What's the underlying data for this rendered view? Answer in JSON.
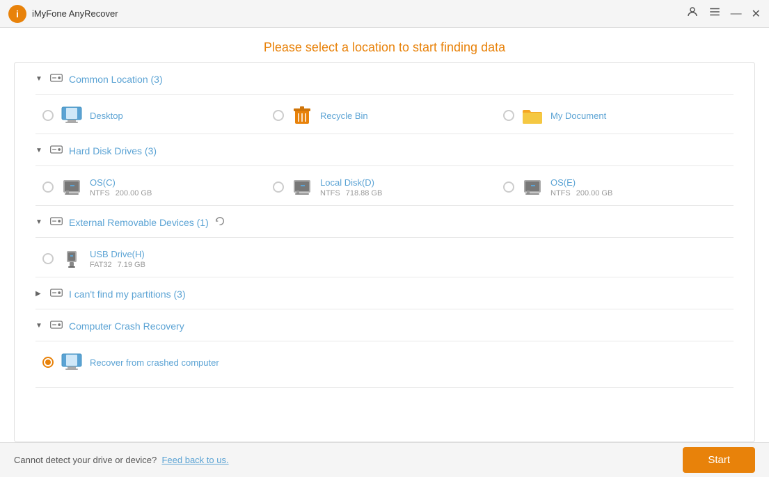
{
  "titlebar": {
    "title": "iMyFone AnyRecover"
  },
  "page": {
    "heading": "Please select a location to start finding data"
  },
  "sections": [
    {
      "id": "common-location",
      "label": "Common Location (3)",
      "expanded": true,
      "arrow": "▼",
      "items": [
        {
          "id": "desktop",
          "name": "Desktop",
          "type": "monitor",
          "selected": false
        },
        {
          "id": "recycle-bin",
          "name": "Recycle Bin",
          "type": "recycle",
          "selected": false
        },
        {
          "id": "my-document",
          "name": "My Document",
          "type": "folder",
          "selected": false
        }
      ]
    },
    {
      "id": "hard-disk",
      "label": "Hard Disk Drives (3)",
      "expanded": true,
      "arrow": "▼",
      "items": [
        {
          "id": "osc",
          "name": "OS(C)",
          "fs": "NTFS",
          "size": "200.00 GB",
          "type": "hdd",
          "selected": false
        },
        {
          "id": "locald",
          "name": "Local Disk(D)",
          "fs": "NTFS",
          "size": "718.88 GB",
          "type": "hdd",
          "selected": false
        },
        {
          "id": "ose",
          "name": "OS(E)",
          "fs": "NTFS",
          "size": "200.00 GB",
          "type": "hdd",
          "selected": false
        }
      ]
    },
    {
      "id": "external",
      "label": "External Removable Devices (1)",
      "expanded": true,
      "arrow": "▼",
      "hasRefresh": true,
      "items": [
        {
          "id": "usbh",
          "name": "USB Drive(H)",
          "fs": "FAT32",
          "size": "7.19 GB",
          "type": "usb",
          "selected": false
        }
      ]
    },
    {
      "id": "partitions",
      "label": "I can't find my partitions (3)",
      "expanded": false,
      "arrow": "▶",
      "items": []
    },
    {
      "id": "crash-recovery",
      "label": "Computer Crash Recovery",
      "expanded": true,
      "arrow": "▼",
      "items": [
        {
          "id": "crashed",
          "name": "Recover from crashed computer",
          "type": "monitor",
          "selected": true
        }
      ]
    }
  ],
  "footer": {
    "text": "Cannot detect your drive or device?",
    "link": "Feed back to us.",
    "start_label": "Start"
  }
}
